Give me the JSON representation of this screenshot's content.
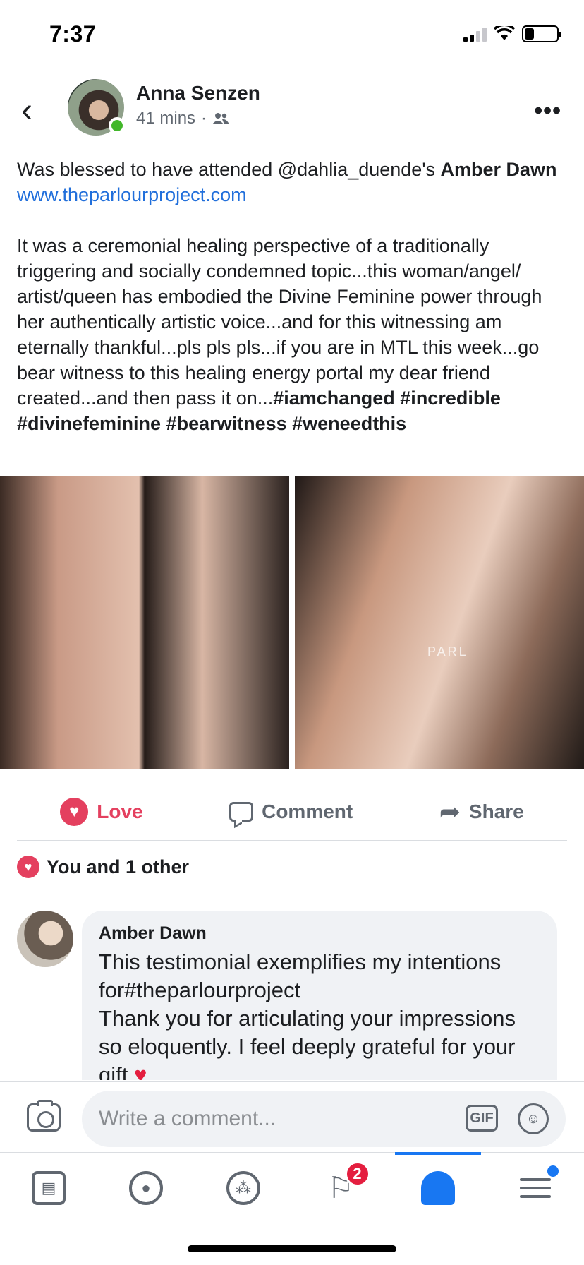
{
  "status_bar": {
    "time": "7:37"
  },
  "post": {
    "author": "Anna Senzen",
    "time_ago": "41 mins",
    "meta_separator": "·",
    "text_intro_prefix": "Was blessed to have attended @dahlia_duende's ",
    "text_intro_bold": "Amber Dawn",
    "link": "www.theparlourproject.com",
    "text_body": "It was a ceremonial healing perspective of a traditionally triggering and socially condemned topic...this woman/angel/ artist/queen has embodied the Divine Feminine power through her authentically artistic voice...and for this witnessing am eternally thankful...pls pls pls...if you are in MTL this week...go bear witness to this healing energy portal my dear friend created...and then pass it on...",
    "hashtags": "#iamchanged #incredible #divinefeminine #bearwitness #weneedthis",
    "photo_caption": "PARL"
  },
  "actions": {
    "love": "Love",
    "comment": "Comment",
    "share": "Share"
  },
  "reactions": {
    "summary": "You and 1 other"
  },
  "comment": {
    "author": "Amber Dawn",
    "line1": "This testimonial exemplifies my intentions for#theparlourproject",
    "line2": "Thank you for articulating your impressions so eloquently. I feel deeply grateful for your gift"
  },
  "composer": {
    "placeholder": "Write a comment...",
    "gif_label": "GIF"
  },
  "nav": {
    "flag_badge": "2"
  },
  "colors": {
    "love": "#e4405f",
    "link": "#216fdb",
    "accent": "#1877f2"
  }
}
